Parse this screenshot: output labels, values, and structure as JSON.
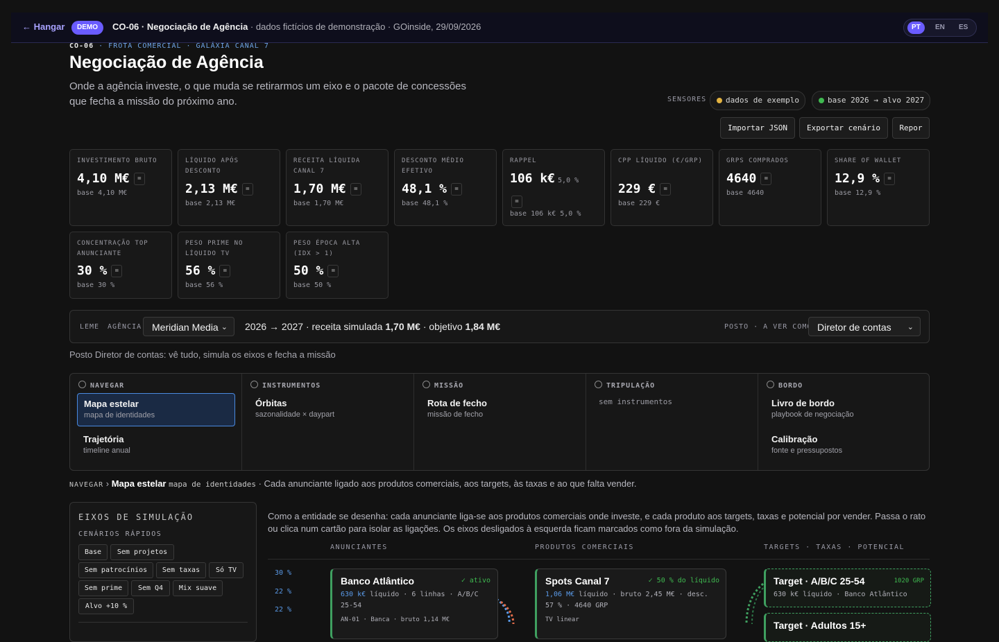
{
  "topbar": {
    "back": "← Hangar",
    "badge": "DEMO",
    "title": "CO-06 · Negociação de Agência",
    "subtitle": " · dados fictícios de demonstração · GOinside, 29/09/2026",
    "langs": [
      "PT",
      "EN",
      "ES"
    ],
    "lang_selected": "PT"
  },
  "header": {
    "crumb_code": "CO-06",
    "crumb_rest": " · FROTA COMERCIAL · GALÁXIA CANAL 7",
    "title": "Negociação de Agência",
    "lead": "Onde a agência investe, o que muda se retirarmos um eixo e o pacote de concessões que fecha a missão do próximo ano.",
    "sensors_label": "SENSORES",
    "sensor_sample": "dados de exemplo",
    "sensor_base": "base 2026 → alvo 2027",
    "sensor_colors": {
      "sample": "#e3b341",
      "base": "#3fb950"
    },
    "buttons": {
      "import": "Importar JSON",
      "export": "Exportar cenário",
      "reset": "Repor"
    }
  },
  "kpis": [
    {
      "label": "Investimento bruto",
      "value": "4,10 M€",
      "eq": "=",
      "base": "base 4,10 M€"
    },
    {
      "label": "Líquido após desconto",
      "value": "2,13 M€",
      "eq": "=",
      "base": "base 2,13 M€"
    },
    {
      "label": "Receita líquida Canal 7",
      "value": "1,70 M€",
      "eq": "=",
      "base": "base 1,70 M€"
    },
    {
      "label": "Desconto médio efetivo",
      "value": "48,1 %",
      "eq": "=",
      "base": "base 48,1 %"
    },
    {
      "label": "Rappel",
      "value": "106 k€",
      "extra": "5,0 %",
      "eq": "=",
      "base": "base 106 k€ 5,0 %"
    },
    {
      "label": "CPP líquido (€/GRP)",
      "value": "229 €",
      "eq": "=",
      "base": "base 229 €"
    },
    {
      "label": "GRPs comprados",
      "value": "4640",
      "eq": "=",
      "base": "base 4640"
    },
    {
      "label": "Share of wallet",
      "value": "12,9 %",
      "eq": "=",
      "base": "base 12,9 %"
    },
    {
      "label": "Concentração top anunciante",
      "value": "30 %",
      "eq": "=",
      "base": "base 30 %"
    },
    {
      "label": "Peso prime no líquido TV",
      "value": "56 %",
      "eq": "=",
      "base": "base 56 %"
    },
    {
      "label": "Peso época alta (IDX > 1)",
      "value": "50 %",
      "eq": "=",
      "base": "base 50 %"
    }
  ],
  "leme": {
    "label": "LEME",
    "agency_label": "AGÊNCIA",
    "agency": "Meridian Media",
    "period": "2026 → 2027",
    "rev_label": " · receita simulada ",
    "rev": "1,70 M€",
    "obj_label": " · objetivo ",
    "obj": "1,84 M€",
    "posto_label": "POSTO · A VER COMO",
    "posto": "Diretor de contas"
  },
  "posto_note": "Posto Diretor de contas: vê tudo, simula os eixos e fecha a missão",
  "nav": {
    "navegar": {
      "title": "NAVEGAR",
      "items": [
        {
          "name": "Mapa estelar",
          "desc": "mapa de identidades"
        },
        {
          "name": "Trajetória",
          "desc": "timeline anual"
        }
      ]
    },
    "instrumentos": {
      "title": "INSTRUMENTOS",
      "items": [
        {
          "name": "Órbitas",
          "desc": "sazonalidade × daypart"
        }
      ]
    },
    "missao": {
      "title": "MISSÃO",
      "items": [
        {
          "name": "Rota de fecho",
          "desc": "missão de fecho"
        }
      ]
    },
    "tripulacao": {
      "title": "TRIPULAÇÃO",
      "empty": "sem instrumentos"
    },
    "bordo": {
      "title": "BORDO",
      "items": [
        {
          "name": "Livro de bordo",
          "desc": "playbook de negociação"
        },
        {
          "name": "Calibração",
          "desc": "fonte e pressupostos"
        }
      ]
    }
  },
  "breadcrumb": {
    "section": "NAVEGAR",
    "sep": " › ",
    "page": "Mapa estelar",
    "mono": "mapa de identidades",
    "text": " · Cada anunciante ligado aos produtos comerciais, aos targets, às taxas e ao que falta vender."
  },
  "eixos": {
    "title": "EIXOS DE SIMULAÇÃO",
    "quick": "CENÁRIOS RÁPIDOS",
    "chips": [
      "Base",
      "Sem projetos",
      "Sem patrocínios",
      "Sem taxas",
      "Só TV",
      "Sem prime",
      "Sem Q4",
      "Mix suave",
      "Alvo +10 %"
    ]
  },
  "map": {
    "description": "Como a entidade se desenha: cada anunciante liga-se aos produtos comerciais onde investe, e cada produto aos targets, taxas e potencial por vender. Passa o rato ou clica num cartão para isolar as ligações. Os eixos desligados à esquerda ficam marcados como fora da simulação.",
    "col_advertisers": "ANUNCIANTES",
    "col_products": "PRODUTOS COMERCIAIS",
    "col_targets": "TARGETS · TAXAS · POTENCIAL",
    "percents": [
      "30 %",
      "22 %",
      "22 %"
    ],
    "advertiser": {
      "name": "Banco Atlântico",
      "status": "✓ ativo",
      "net": "630 k€",
      "line1": " líquido · 6 linhas · A/B/C 25-54",
      "line2": "AN-01 · Banca · bruto 1,14 M€"
    },
    "product": {
      "name": "Spots Canal 7",
      "status": "✓ 50 % do líquido",
      "net": "1,06 M€",
      "line1": " líquido · bruto 2,45 M€ · desc. 57 % · 4640 GRP",
      "line2": "TV linear"
    },
    "target": {
      "name": "Target · A/B/C 25-54",
      "grp": "1020 GRP",
      "line1": "630 k€ líquido · Banco Atlântico",
      "next": "Target · Adultos 15+"
    }
  }
}
